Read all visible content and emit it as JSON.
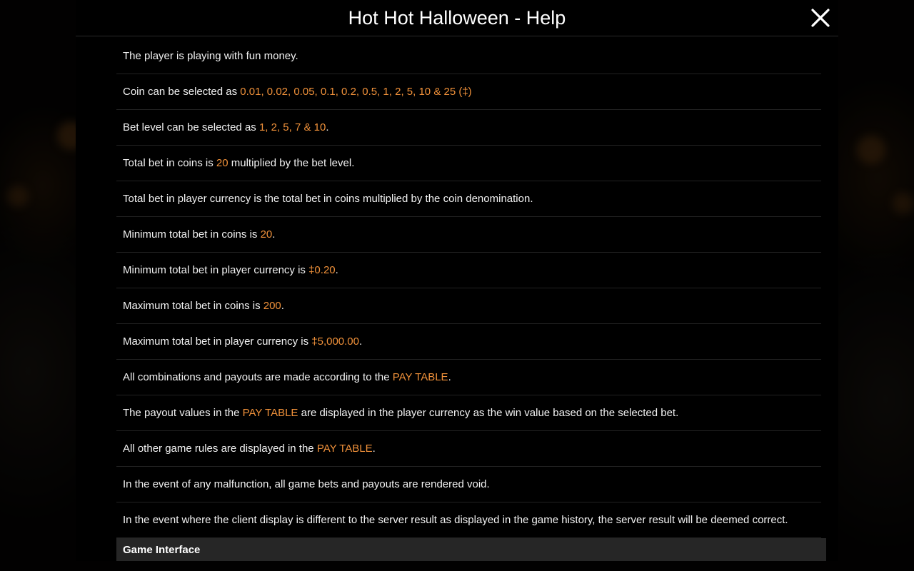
{
  "header": {
    "title": "Hot Hot Halloween - Help"
  },
  "rules": [
    {
      "pre": "The player is playing with fun money.",
      "hl": "",
      "post": ""
    },
    {
      "pre": "Coin can be selected as ",
      "hl": "0.01, 0.02, 0.05, 0.1, 0.2, 0.5, 1, 2, 5, 10 & 25 (‡)",
      "post": ""
    },
    {
      "pre": "Bet level can be selected as ",
      "hl": "1, 2, 5, 7 & 10",
      "post": "."
    },
    {
      "pre": "Total bet in coins is ",
      "hl": "20",
      "post": " multiplied by the bet level."
    },
    {
      "pre": "Total bet in player currency is the total bet in coins multiplied by the coin denomination.",
      "hl": "",
      "post": ""
    },
    {
      "pre": "Minimum total bet in coins is ",
      "hl": "20",
      "post": "."
    },
    {
      "pre": "Minimum total bet in player currency is ",
      "hl": "‡0.20",
      "post": "."
    },
    {
      "pre": "Maximum total bet in coins is ",
      "hl": "200",
      "post": "."
    },
    {
      "pre": "Maximum total bet in player currency is ",
      "hl": "‡5,000.00",
      "post": "."
    },
    {
      "pre": "All combinations and payouts are made according to the ",
      "hl": "PAY TABLE",
      "post": "."
    },
    {
      "pre": "The payout values in the ",
      "hl": "PAY TABLE",
      "post": " are displayed in the player currency as the win value based on the selected bet."
    },
    {
      "pre": "All other game rules are displayed in the ",
      "hl": "PAY TABLE",
      "post": "."
    },
    {
      "pre": "In the event of any malfunction, all game bets and payouts are rendered void.",
      "hl": "",
      "post": ""
    },
    {
      "pre": "In the event where the client display is different to the server result as displayed in the game history, the server result will be deemed correct.",
      "hl": "",
      "post": ""
    }
  ],
  "section": {
    "heading": "Game Interface"
  },
  "icons": {
    "close": "close-icon"
  },
  "colors": {
    "highlight": "#f0913a",
    "background": "#000000",
    "section_bg": "#262626"
  }
}
